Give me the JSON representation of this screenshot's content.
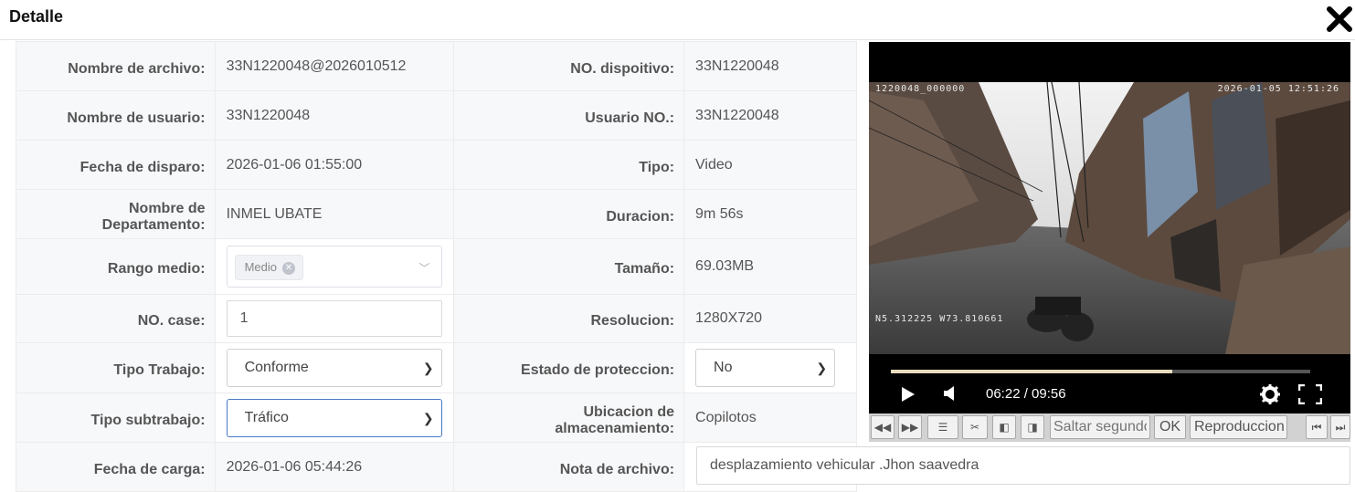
{
  "header": {
    "title": "Detalle"
  },
  "rows": {
    "file_name": {
      "label": "Nombre de archivo:",
      "value": "33N1220048@2026010512"
    },
    "device_no": {
      "label": "NO. dispoitivo:",
      "value": "33N1220048"
    },
    "user_name": {
      "label": "Nombre de usuario:",
      "value": "33N1220048"
    },
    "user_no": {
      "label": "Usuario NO.:",
      "value": "33N1220048"
    },
    "shot_date": {
      "label": "Fecha de disparo:",
      "value": "2026-01-06 01:55:00"
    },
    "type": {
      "label": "Tipo:",
      "value": "Video"
    },
    "department": {
      "label": "Nombre de Departamento:",
      "value": "INMEL UBATE"
    },
    "duration": {
      "label": "Duracion:",
      "value": "9m 56s"
    },
    "media_range": {
      "label": "Rango medio:",
      "tag": "Medio"
    },
    "size": {
      "label": "Tamaño:",
      "value": "69.03MB"
    },
    "case_no": {
      "label": "NO. case:",
      "value": "1"
    },
    "resolution": {
      "label": "Resolucion:",
      "value": "1280X720"
    },
    "work_type": {
      "label": "Tipo Trabajo:",
      "value": "Conforme"
    },
    "protection": {
      "label": "Estado de proteccion:",
      "value": "No"
    },
    "subwork_type": {
      "label": "Tipo subtrabajo:",
      "value": "Tráfico"
    },
    "storage": {
      "label": "Ubicacion de almacenamiento:",
      "value": "Copilotos"
    },
    "upload_date": {
      "label": "Fecha de carga:",
      "value": "2026-01-06 05:44:26"
    },
    "file_note": {
      "label": "Nota de archivo:",
      "value": "desplazamiento vehicular .Jhon saavedra"
    }
  },
  "player": {
    "osd_top_left": "1220048_000000",
    "osd_top_right": "2026-01-05 12:51:26",
    "osd_bottom_left": "N5.312225  W73.810661",
    "time": "06:22 / 09:56",
    "progress_fraction": 0.67,
    "buffered_fraction": 1.0
  },
  "toolbar": {
    "skip_placeholder": "Saltar segundos",
    "ok_label": "OK",
    "play_label": "Reproduccion"
  }
}
